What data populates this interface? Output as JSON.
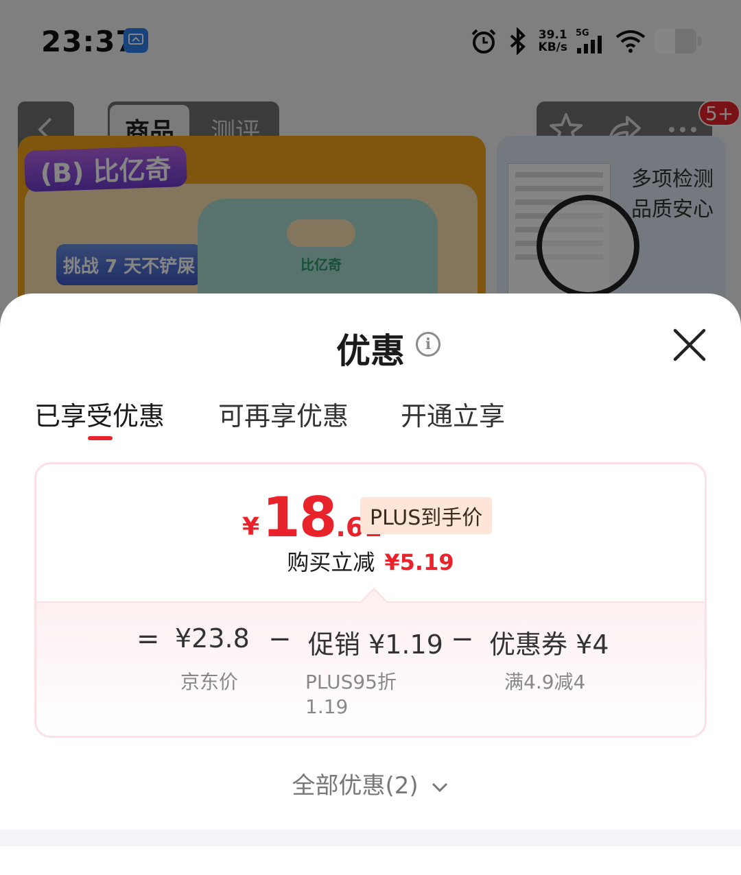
{
  "status_bar": {
    "time": "23:37",
    "net_speed_value": "39.1",
    "net_speed_unit": "KB/s",
    "network_type": "5G",
    "battery_level": 0.5
  },
  "nav": {
    "tabs": [
      "商品",
      "测评"
    ],
    "active_tab": "商品",
    "cart_badge": "5+"
  },
  "banner": {
    "brand": "(B) 比亿奇",
    "promo": "挑战 7 天不铲屎",
    "bag_logo": "比亿奇"
  },
  "thumb": {
    "line1": "多项检测",
    "line2": "品质安心"
  },
  "sheet": {
    "title": "优惠",
    "tabs": [
      "已享受优惠",
      "可再享优惠",
      "开通立享"
    ],
    "active_tab": "已享受优惠"
  },
  "price": {
    "currency": "¥",
    "integer": "18",
    "decimal": ".61",
    "tag": "PLUS到手价",
    "cut_label": "购买立减",
    "cut_value": "¥5.19"
  },
  "formula": {
    "equals": "=",
    "minus": "−",
    "jd_price": "¥23.8",
    "jd_price_label": "京东价",
    "promo": "促销 ¥1.19",
    "promo_label_1": "PLUS95折",
    "promo_label_2": "1.19",
    "coupon": "优惠券 ¥4",
    "coupon_label": "满4.9减4"
  },
  "all_offers": "全部优惠(2)",
  "colors": {
    "accent_red": "#e8232b",
    "card_border": "#fde0e3",
    "plus_tag_bg": "#fde6d8"
  }
}
